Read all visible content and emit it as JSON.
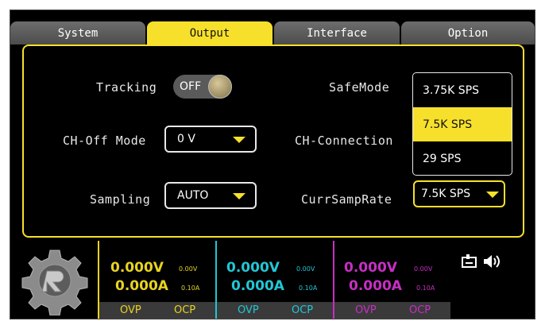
{
  "tabs": [
    {
      "label": "System"
    },
    {
      "label": "Output"
    },
    {
      "label": "Interface"
    },
    {
      "label": "Option"
    }
  ],
  "settings": {
    "tracking": {
      "label": "Tracking",
      "value": "OFF"
    },
    "ch_off_mode": {
      "label": "CH-Off Mode",
      "value": "0 V"
    },
    "sampling": {
      "label": "Sampling",
      "value": "AUTO"
    },
    "safe_mode": {
      "label": "SafeMode"
    },
    "ch_connection": {
      "label": "CH-Connection"
    },
    "curr_samp_rate": {
      "label": "CurrSampRate",
      "value": "7.5K SPS"
    }
  },
  "samp_rate_options": [
    "3.75K SPS",
    "7.5K SPS",
    "29 SPS"
  ],
  "channels": [
    {
      "volt": "0.000V",
      "volt_set": "0.00V",
      "amp": "0.000A",
      "amp_set": "0.10A",
      "ovp": "OVP",
      "ocp": "OCP",
      "color": "#e8d321"
    },
    {
      "volt": "0.000V",
      "volt_set": "0.00V",
      "amp": "0.000A",
      "amp_set": "0.10A",
      "ovp": "OVP",
      "ocp": "OCP",
      "color": "#22c6d6"
    },
    {
      "volt": "0.000V",
      "volt_set": "0.00V",
      "amp": "0.000A",
      "amp_set": "0.10A",
      "ovp": "OVP",
      "ocp": "OCP",
      "color": "#c72fc4"
    }
  ],
  "colors": {
    "accent": "#f7e02b",
    "tab_inactive": "#5a5a5a"
  },
  "status_icons": [
    "usb-device-icon",
    "speaker-icon"
  ]
}
